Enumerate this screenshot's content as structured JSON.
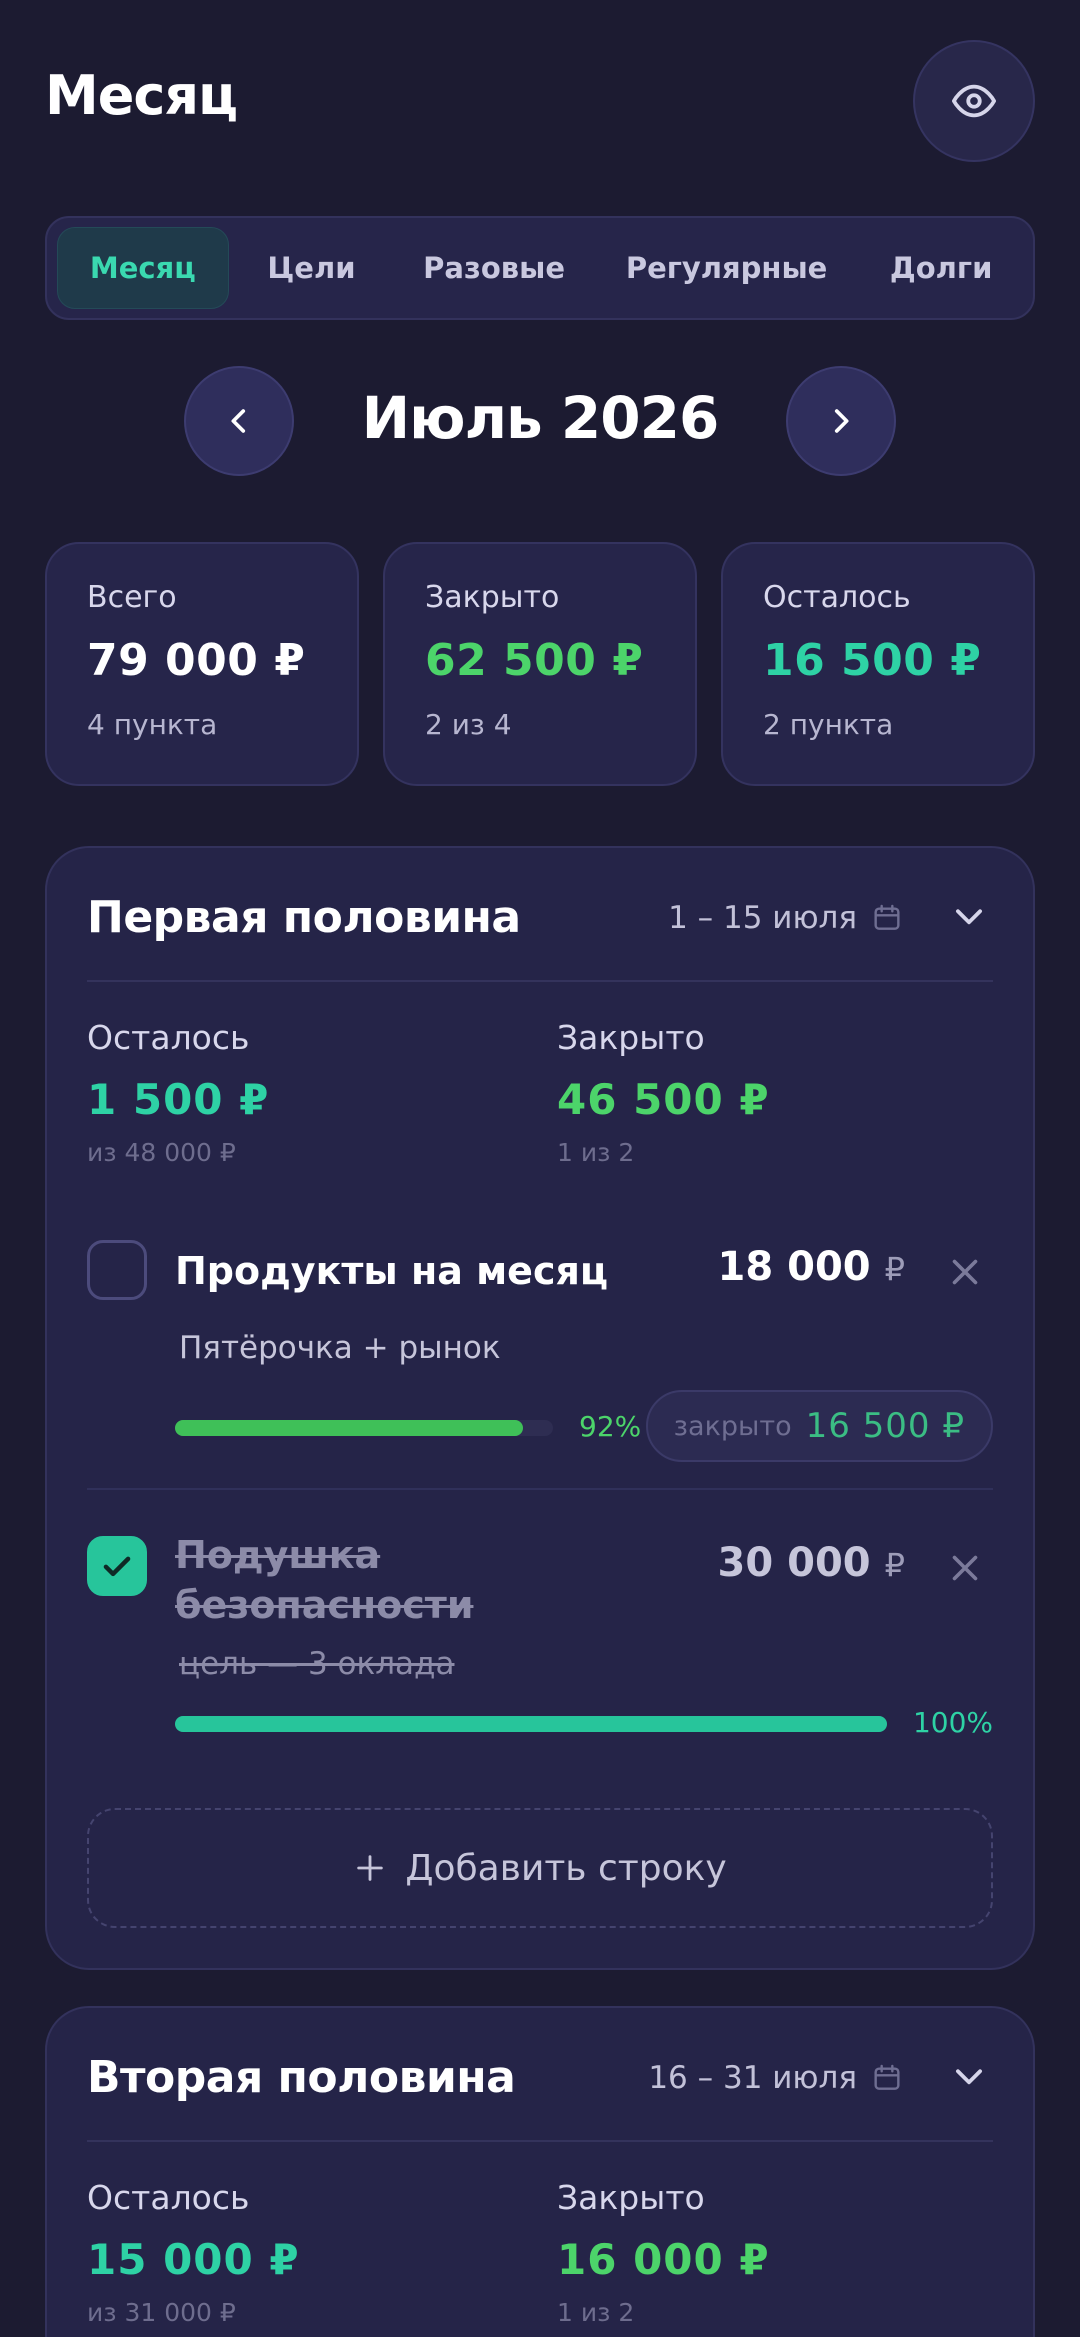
{
  "header": {
    "title": "Месяц",
    "eye_icon": "eye-icon"
  },
  "tabs": [
    {
      "label": "Месяц",
      "active": true
    },
    {
      "label": "Цели",
      "active": false
    },
    {
      "label": "Разовые",
      "active": false
    },
    {
      "label": "Регулярные",
      "active": false
    },
    {
      "label": "Долги",
      "active": false
    }
  ],
  "month_nav": {
    "title": "Июль 2026",
    "prev_icon": "chevron-left-icon",
    "next_icon": "chevron-right-icon"
  },
  "summary": [
    {
      "label": "Всего",
      "value": "79 000 ₽",
      "sub": "4 пункта",
      "color": "#ffffff"
    },
    {
      "label": "Закрыто",
      "value": "62 500 ₽",
      "sub": "2 из 4",
      "color": "#4cd46a"
    },
    {
      "label": "Осталось",
      "value": "16 500 ₽",
      "sub": "2 пункта",
      "color": "#2ed2a5"
    }
  ],
  "sections": [
    {
      "title": "Первая половина",
      "dates": "1 – 15 июля",
      "remaining_label": "Осталось",
      "remaining_value": "1 500 ₽",
      "remaining_sub": "из 48 000 ₽",
      "closed_label": "Закрыто",
      "closed_value": "46 500 ₽",
      "closed_sub": "1 из 2",
      "items": [
        {
          "title": "Продукты на месяц",
          "amount": "18 000",
          "currency": "₽",
          "note": "Пятёрочка + рынок",
          "progress": 0.92,
          "progress_label": "92%",
          "done": false,
          "closed_label": "закрыто",
          "closed_value": "16 500 ₽"
        },
        {
          "title_line1": "Подушка",
          "title_line2": "безопасности",
          "amount": "30 000",
          "currency": "₽",
          "note": "цель — 3 оклада",
          "progress": 1.0,
          "progress_label": "100%",
          "done": true
        }
      ],
      "add_label": "Добавить строку"
    },
    {
      "title": "Вторая половина",
      "dates": "16 – 31 июля",
      "remaining_label": "Осталось",
      "remaining_value": "15 000 ₽",
      "remaining_sub": "из 31 000 ₽",
      "closed_label": "Закрыто",
      "closed_value": "16 000 ₽",
      "closed_sub": "1 из 2"
    }
  ],
  "colors": {
    "background": "#1c1b31",
    "card": "#26254a",
    "green": "#4cd46a",
    "teal": "#2ed2a5"
  }
}
